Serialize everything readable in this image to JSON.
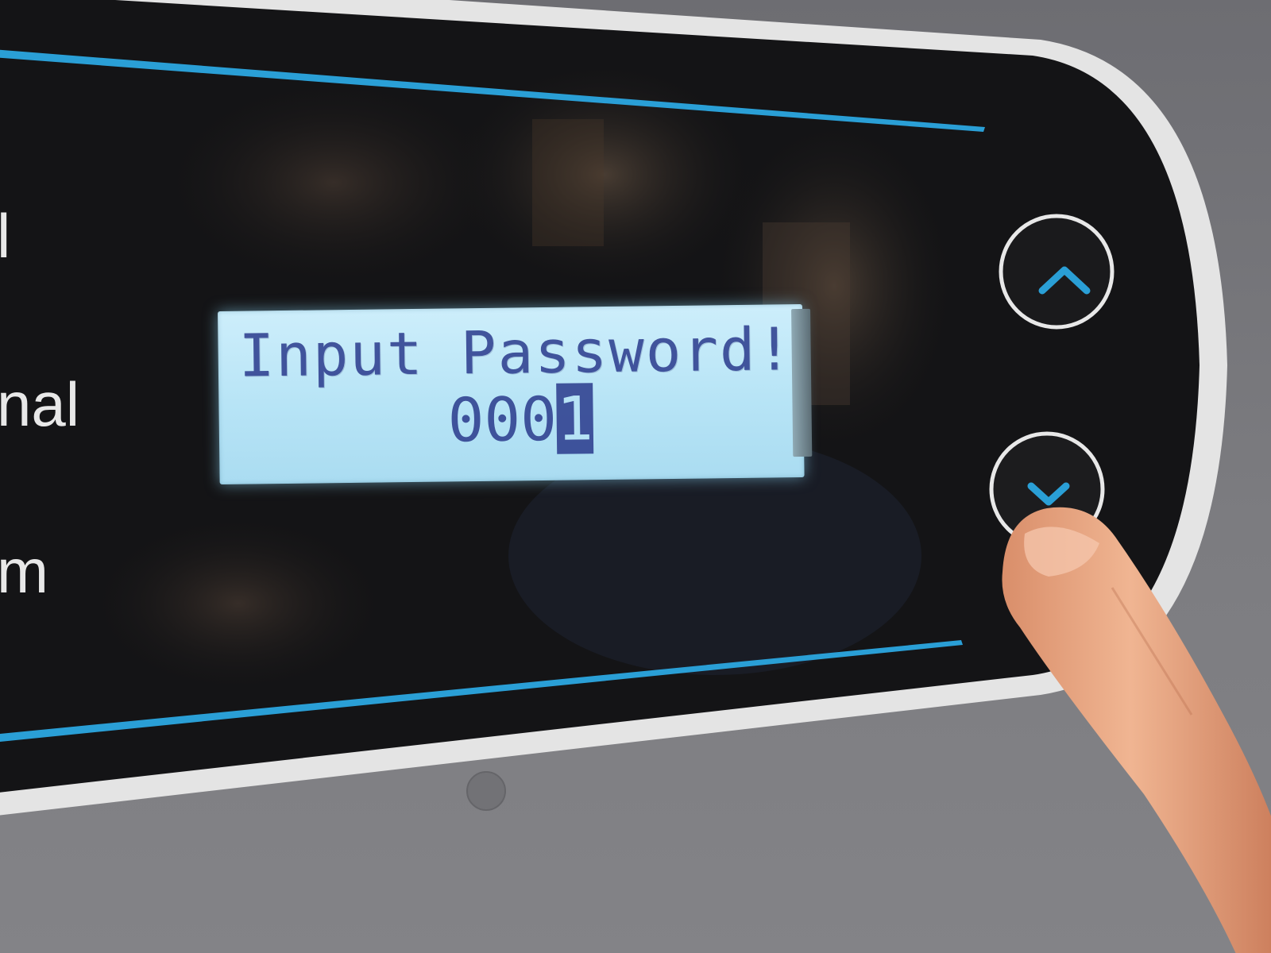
{
  "panel": {
    "side_labels": [
      "l",
      "nal",
      "m"
    ],
    "display": {
      "line1": "Input Password!",
      "password_entered": "000",
      "password_cursor_digit": "1"
    },
    "buttons": {
      "up": "up",
      "down": "down"
    }
  },
  "colors": {
    "accent_blue": "#2a9fd6",
    "lcd_background": "#b7e4f6",
    "lcd_text": "#2a3a8c",
    "panel_black": "#121214",
    "housing_gray": "#7a7a7e",
    "trim_white": "#e6e6e6"
  }
}
